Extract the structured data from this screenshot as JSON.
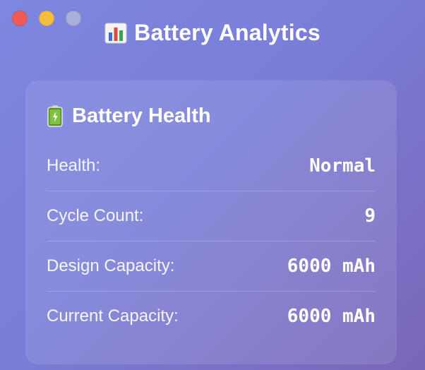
{
  "window": {
    "title": "Battery Analytics",
    "title_icon": "bar-chart-icon"
  },
  "card": {
    "heading": "Battery Health",
    "heading_icon": "battery-icon",
    "rows": [
      {
        "label": "Health:",
        "value": "Normal"
      },
      {
        "label": "Cycle Count:",
        "value": "9"
      },
      {
        "label": "Design Capacity:",
        "value": "6000 mAh"
      },
      {
        "label": "Current Capacity:",
        "value": "6000 mAh"
      }
    ]
  },
  "colors": {
    "background_start": "#7d86e0",
    "background_end": "#7a66b8",
    "close": "#f05c55",
    "minimize": "#f5bd3d",
    "zoom_inactive": "#aab0d8"
  }
}
